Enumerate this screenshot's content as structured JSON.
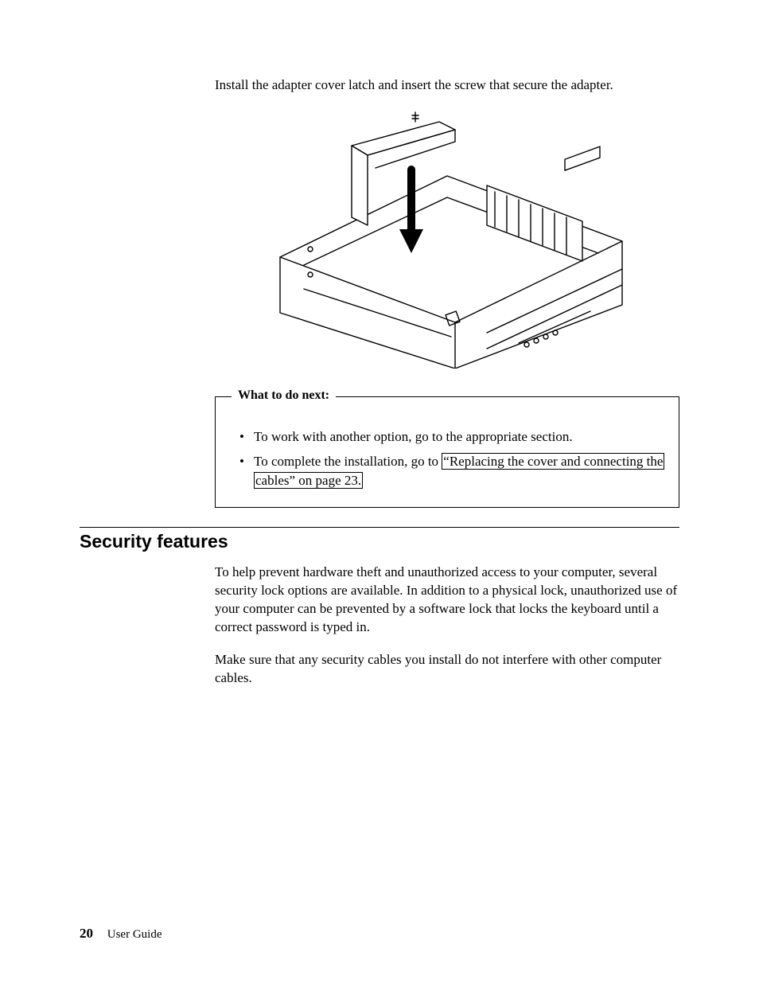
{
  "intro_text": "Install the adapter cover latch and insert the screw that secure the adapter.",
  "box": {
    "title": "What to do next:",
    "items": [
      {
        "text": "To work with another option, go to the appropriate section."
      },
      {
        "pre": "To complete the installation, go to ",
        "link1": "“Replacing the cover and connecting the",
        "link2": "cables” on page 23."
      }
    ]
  },
  "section": {
    "heading": "Security features",
    "para1": "To help prevent hardware theft and unauthorized access to your computer, several security lock options are available. In addition to a physical lock, unauthorized use of your computer can be prevented by a software lock that locks the keyboard until a correct password is typed in.",
    "para2": "Make sure that any security cables you install do not interfere with other computer cables."
  },
  "footer": {
    "page_number": "20",
    "label": "User Guide"
  }
}
